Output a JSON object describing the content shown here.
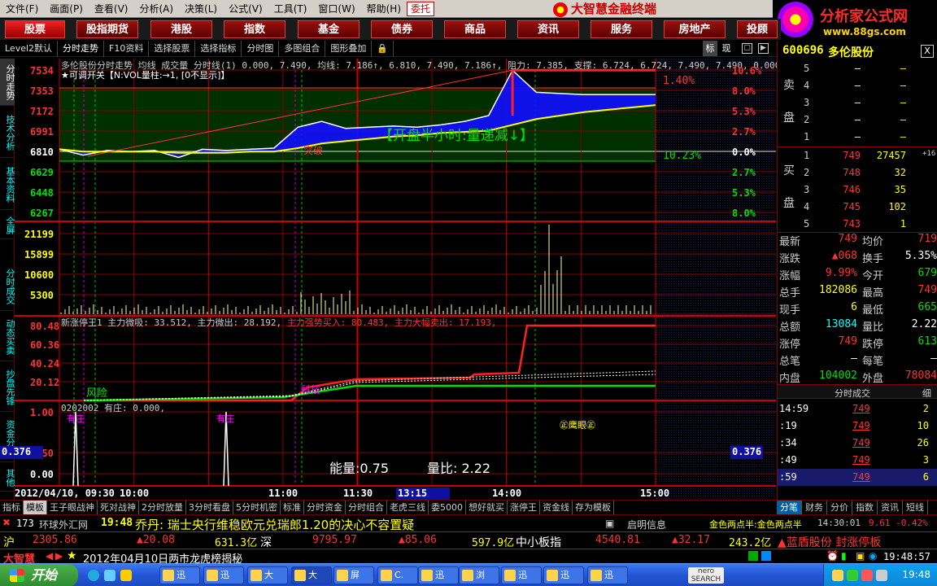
{
  "menu": [
    "文件(F)",
    "画面(P)",
    "查看(V)",
    "分析(A)",
    "决策(L)",
    "公式(V)",
    "工具(T)",
    "窗口(W)",
    "帮助(H)"
  ],
  "menu_entrust": "委托",
  "brand": "大智慧金融终端",
  "watermark": {
    "title": "分析家公式网",
    "url": "www.88gs.com"
  },
  "categories": [
    "股票",
    "股指期货",
    "港股",
    "指数",
    "基金",
    "债券",
    "商品",
    "资讯",
    "服务",
    "房地产",
    "投顾"
  ],
  "subtoolbar": [
    "Level2默认",
    "分时走势",
    "F10资料",
    "选择股票",
    "选择指标",
    "分时图",
    "多图组合",
    "图形叠加"
  ],
  "subtoolbar_right": [
    "标",
    "现"
  ],
  "vtabs": [
    "分时走势",
    "技术分析",
    "基本资料",
    "全屏",
    "分时成交",
    "动态买卖",
    "抄盘先锋",
    "资金分时",
    "其他"
  ],
  "chart": {
    "header": "多伦股份分时走势 均线 成交量 分时线(1) 0.000, 7.490, 均线: 7.186↑, 6.810, 7.490, 7.186↑, 阻力: 7.385, 支撑: 6.724, 6.724, 7.490, 7.490, 0.000,",
    "switch_label": "★可调开关【N:VOL量柱:→1, [0不显示]】",
    "annotation_main": "【开盘半小时:量递减↓】",
    "breakout_label": "突破",
    "pct_top": "1.40%",
    "pct_bottom": "10.23%",
    "price_axis": [
      "7534",
      "7353",
      "7172",
      "6991",
      "6810",
      "6629",
      "6448",
      "6267"
    ],
    "pct_axis": [
      "10.6%",
      "8.0%",
      "5.3%",
      "2.7%",
      "0.0%",
      "2.7%",
      "5.3%",
      "8.0%"
    ],
    "vol_axis": [
      "21199",
      "15899",
      "10600",
      "5300"
    ],
    "ind1_header": "新涨停王1 主力微吸: 33.512, 主力微出: 28.192,",
    "ind1_header_red": "主力强势买入: 80.483, 主力大幅卖出: 17.193,",
    "ind1_axis": [
      "80.48",
      "60.36",
      "40.24",
      "20.12"
    ],
    "ind1_risk": "风险",
    "ind1_mark": "科技",
    "ind2_header": "0202002 有庄: 0.000,",
    "ind2_axis": [
      "1.00",
      "0.376",
      "0.50",
      "0.00"
    ],
    "ind2_tag": "有庄",
    "ind2_tag2": "有庄",
    "ind2_eye": "㊣鹰眼㊣",
    "ind2_energy": "能量:0.75",
    "ind2_ratio": "量比: 2.22",
    "ind2_cursor": "0.376",
    "time_axis": [
      "2012/04/10, 09:30",
      "10:00",
      "11:00",
      "11:30",
      "13:15",
      "14:00",
      "15:00"
    ]
  },
  "chart_data": {
    "type": "line",
    "x": [
      "09:30",
      "09:40",
      "09:50",
      "10:00",
      "10:10",
      "10:20",
      "10:30",
      "10:40",
      "10:50",
      "11:00",
      "11:10",
      "11:20",
      "11:30",
      "13:10",
      "13:20",
      "13:30",
      "13:40",
      "13:50",
      "14:00",
      "14:05",
      "14:10",
      "14:20",
      "14:30",
      "14:40",
      "14:50",
      "15:00"
    ],
    "series": [
      {
        "name": "分时线",
        "values": [
          6.81,
          6.76,
          6.8,
          6.79,
          6.8,
          6.74,
          6.81,
          6.8,
          6.81,
          6.82,
          7.0,
          7.05,
          6.99,
          7.0,
          7.01,
          7.0,
          7.02,
          7.05,
          7.1,
          7.49,
          7.3,
          7.29,
          7.28,
          7.28,
          7.28,
          7.28
        ]
      },
      {
        "name": "均线",
        "values": [
          6.81,
          6.79,
          6.79,
          6.79,
          6.79,
          6.78,
          6.78,
          6.78,
          6.79,
          6.79,
          6.82,
          6.86,
          6.88,
          6.9,
          6.92,
          6.93,
          6.95,
          6.96,
          6.97,
          7.02,
          7.07,
          7.1,
          7.13,
          7.15,
          7.17,
          7.19
        ]
      }
    ],
    "ylim": [
      6267,
      7534
    ]
  },
  "stock": {
    "code": "600696",
    "name": "多伦股份",
    "close": "X"
  },
  "orderbook": {
    "sell_label": [
      "卖",
      "盘"
    ],
    "buy_label": [
      "买",
      "盘"
    ],
    "sell": [
      {
        "lvl": "5",
        "price": "–",
        "vol": "–"
      },
      {
        "lvl": "4",
        "price": "–",
        "vol": "–"
      },
      {
        "lvl": "3",
        "price": "–",
        "vol": "–"
      },
      {
        "lvl": "2",
        "price": "–",
        "vol": "–"
      },
      {
        "lvl": "1",
        "price": "–",
        "vol": "–"
      }
    ],
    "buy": [
      {
        "lvl": "1",
        "price": "749",
        "vol": "27457",
        "extra": "+16"
      },
      {
        "lvl": "2",
        "price": "748",
        "vol": "32",
        "extra": ""
      },
      {
        "lvl": "3",
        "price": "746",
        "vol": "35",
        "extra": ""
      },
      {
        "lvl": "4",
        "price": "745",
        "vol": "102",
        "extra": ""
      },
      {
        "lvl": "5",
        "price": "743",
        "vol": "1",
        "extra": ""
      }
    ]
  },
  "stats": [
    {
      "k1": "最新",
      "v1": "749",
      "c1": "red",
      "k2": "均价",
      "v2": "719",
      "c2": "red"
    },
    {
      "k1": "涨跌",
      "v1": "▲068",
      "c1": "red",
      "k2": "换手",
      "v2": "5.35%",
      "c2": "white"
    },
    {
      "k1": "涨幅",
      "v1": "9.99%",
      "c1": "red",
      "k2": "今开",
      "v2": "679",
      "c2": "green"
    },
    {
      "k1": "总手",
      "v1": "182086",
      "c1": "yellow",
      "k2": "最高",
      "v2": "749",
      "c2": "red"
    },
    {
      "k1": "现手",
      "v1": "6",
      "c1": "yellow",
      "k2": "最低",
      "v2": "665",
      "c2": "green"
    },
    {
      "k1": "总额",
      "v1": "13084",
      "c1": "cyan",
      "k2": "量比",
      "v2": "2.22",
      "c2": "white"
    },
    {
      "k1": "涨停",
      "v1": "749",
      "c1": "red",
      "k2": "跌停",
      "v2": "613",
      "c2": "green"
    },
    {
      "k1": "总笔",
      "v1": "–",
      "c1": "white",
      "k2": "每笔",
      "v2": "–",
      "c2": "white"
    },
    {
      "k1": "内盘",
      "v1": "104002",
      "c1": "green",
      "k2": "外盘",
      "v2": "78084",
      "c2": "red"
    }
  ],
  "ticks_header": "分时成交",
  "ticks_button": "细",
  "ticks": [
    {
      "t": "14:59",
      "p": "749",
      "v": "2"
    },
    {
      "t": ":19",
      "p": "749",
      "v": "10"
    },
    {
      "t": ":34",
      "p": "749",
      "v": "26"
    },
    {
      "t": ":49",
      "p": "749",
      "v": "3"
    },
    {
      "t": ":59",
      "p": "749",
      "v": "6"
    }
  ],
  "bottom_tabs": [
    "指标",
    "模板",
    "王子眼战神",
    "死对战神",
    "2分时放量",
    "3分时看盘",
    "5分时机密",
    "标准",
    "分时资金",
    "分时组合",
    "老虎三线",
    "委5000",
    "想好就买",
    "涨停王",
    "资金线",
    "存为模板"
  ],
  "right_tabs": [
    "分笔",
    "财务",
    "分价",
    "指数",
    "资讯",
    "短线"
  ],
  "news": {
    "count": "173",
    "source": "环球外汇网",
    "time": "19:48",
    "text": "乔丹: 瑞士央行维稳欧元兑瑞郎1.20的决心不容置疑",
    "info_label": "启明信息",
    "gold": "金色两点半:金色两点半",
    "gold_time": "14:30:01",
    "gold_val": "9.61 -0.42%"
  },
  "indexbar": {
    "sh_label": "沪",
    "sh_val": "2305.86",
    "sh_chg": "▲20.08",
    "sh_amt": "631.3亿",
    "sz_label": "深",
    "sz_val": "9795.97",
    "sz_chg": "▲85.06",
    "sz_amt": "597.9亿",
    "zxb_label": "中小板指",
    "zxb_val": "4540.81",
    "zxb_chg": "▲32.17",
    "zxb_amt": "243.2亿",
    "alert": "▲蓝盾股份 封涨停板"
  },
  "footer": {
    "brand": "大智慧",
    "text": "2012年04月10日两市龙虎榜揭秘",
    "time": "19:48:57"
  },
  "taskbar": {
    "start": "开始",
    "tasks": [
      "迅",
      "迅",
      "大",
      "大",
      "屏",
      "C.",
      "迅",
      "浏",
      "迅",
      "迅",
      "迅"
    ],
    "clock": "19:48"
  },
  "colors": {
    "red": "#ff3232",
    "green": "#00e000",
    "yellow": "#ffff00",
    "panel_bg": "#003000",
    "blue_fill": "#1010ff"
  }
}
